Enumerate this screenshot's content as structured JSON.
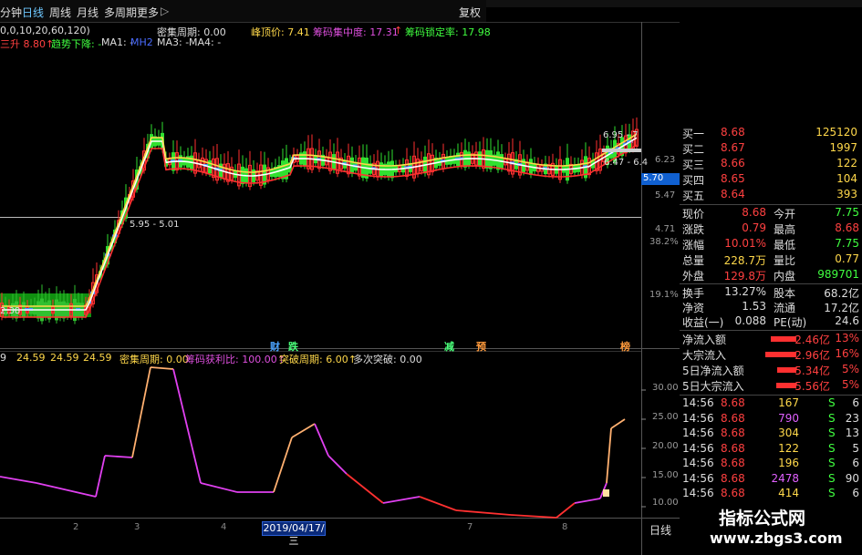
{
  "toolbar": {
    "tabs": [
      "分钟",
      "日线",
      "周线",
      "月线",
      "多周期",
      "更多"
    ],
    "more_arrow": "▷",
    "restore_label": "复权"
  },
  "main_indicators": {
    "line1_left": "0,0,10,20,60,120)",
    "line1_mid_label": "密集周期: 0.00",
    "line1_peak_label": "峰顶价: 7.41",
    "line1_a_label": "筹码集中度: 17.31",
    "line1_a_arrow": "↑",
    "line1_b_label": "筹码锁定率: 17.98",
    "line2_a": "三升 8.80↑",
    "line2_b": "趋势下降: -",
    "line2_c": "MA1: -",
    "line2_d": "MH2",
    "line2_e": "MA3: -",
    "line2_f": "MA4: -"
  },
  "main_axis": {
    "labels": [
      "6.95 - 7",
      "6.23",
      "6.47 - 6.4",
      "5.70",
      "5.47",
      "4.71",
      "38.2%",
      "19.1%",
      "2.38",
      "5.95 - 5.01"
    ],
    "price_marker": "5.70"
  },
  "signals": [
    {
      "text": "财",
      "color": "#4aa3ff"
    },
    {
      "text": "跌",
      "color": "#4aff7a"
    },
    {
      "text": "减",
      "color": "#4aff7a"
    },
    {
      "text": "预",
      "color": "#ff9a3c"
    },
    {
      "text": "榜",
      "color": "#ff9a3c"
    }
  ],
  "sub_indicators": {
    "a": "9",
    "b": "24.59",
    "c": "24.59",
    "d": "24.59",
    "e": "密集周期: 0.00",
    "f": "筹码获利比: 100.00↑",
    "g": "突破周期: 6.00↑",
    "h": "多次突破: 0.00"
  },
  "sub_axis": [
    "30.00",
    "25.00",
    "20.00",
    "15.00",
    "10.00"
  ],
  "x_axis": [
    "2",
    "3",
    "4",
    "7",
    "8"
  ],
  "date_label": "2019/04/17/三",
  "period_label": "日线",
  "quote": {
    "bids": [
      {
        "label": "买一",
        "price": "8.68",
        "vol": "125120"
      },
      {
        "label": "买二",
        "price": "8.67",
        "vol": "1997"
      },
      {
        "label": "买三",
        "price": "8.66",
        "vol": "122"
      },
      {
        "label": "买四",
        "price": "8.65",
        "vol": "104"
      },
      {
        "label": "买五",
        "price": "8.64",
        "vol": "393"
      }
    ],
    "stats": [
      {
        "l1": "现价",
        "v1": "8.68",
        "l2": "今开",
        "v2": "7.75",
        "c1": "#ff4040",
        "c2": "#40ff40"
      },
      {
        "l1": "涨跌",
        "v1": "0.79",
        "l2": "最高",
        "v2": "8.68",
        "c1": "#ff4040",
        "c2": "#ff4040"
      },
      {
        "l1": "涨幅",
        "v1": "10.01%",
        "l2": "最低",
        "v2": "7.75",
        "c1": "#ff4040",
        "c2": "#40ff40"
      },
      {
        "l1": "总量",
        "v1": "228.7万",
        "l2": "量比",
        "v2": "0.77",
        "c1": "#ffd84a",
        "c2": "#ffd84a"
      },
      {
        "l1": "外盘",
        "v1": "129.8万",
        "l2": "内盘",
        "v2": "989701",
        "c1": "#ff4040",
        "c2": "#40ff40"
      }
    ],
    "fund": [
      {
        "l1": "换手",
        "v1": "13.27%",
        "l2": "股本",
        "v2": "68.2亿"
      },
      {
        "l1": "净资",
        "v1": "1.53",
        "l2": "流通",
        "v2": "17.2亿"
      },
      {
        "l1": "收益(一)",
        "v1": "0.088",
        "l2": "PE(动)",
        "v2": "24.6"
      }
    ],
    "flows": [
      {
        "label": "净流入额",
        "val": "2.46亿",
        "pct": "13%",
        "bar": 40
      },
      {
        "label": "大宗流入",
        "val": "2.96亿",
        "pct": "16%",
        "bar": 48
      },
      {
        "label": "5日净流入额",
        "val": "5.34亿",
        "pct": "5%",
        "bar": 30
      },
      {
        "label": "5日大宗流入",
        "val": "5.56亿",
        "pct": "5%",
        "bar": 32
      }
    ],
    "ticks": [
      {
        "time": "14:56",
        "price": "8.68",
        "vol": "167",
        "side": "S",
        "n": "6",
        "vc": "#ffd84a"
      },
      {
        "time": "14:56",
        "price": "8.68",
        "vol": "790",
        "side": "S",
        "n": "23",
        "vc": "#e060ff"
      },
      {
        "time": "14:56",
        "price": "8.68",
        "vol": "304",
        "side": "S",
        "n": "13",
        "vc": "#ffd84a"
      },
      {
        "time": "14:56",
        "price": "8.68",
        "vol": "122",
        "side": "S",
        "n": "5",
        "vc": "#ffd84a"
      },
      {
        "time": "14:56",
        "price": "8.68",
        "vol": "196",
        "side": "S",
        "n": "6",
        "vc": "#ffd84a"
      },
      {
        "time": "14:56",
        "price": "8.68",
        "vol": "2478",
        "side": "S",
        "n": "90",
        "vc": "#e060ff"
      },
      {
        "time": "14:56",
        "price": "8.68",
        "vol": "414",
        "side": "S",
        "n": "6",
        "vc": "#ffd84a"
      }
    ]
  },
  "watermark": {
    "line1": "指标公式网",
    "line2": "www.zbgs3.com"
  }
}
